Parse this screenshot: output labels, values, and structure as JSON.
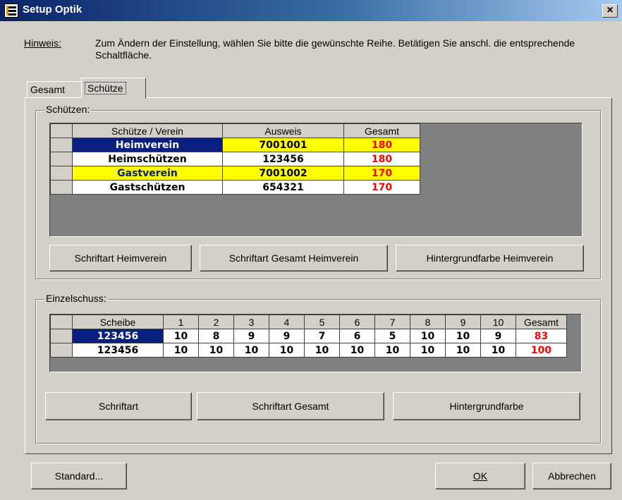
{
  "window": {
    "title": "Setup Optik",
    "close_label": "×"
  },
  "hint": {
    "label": "Hinweis:",
    "text": "Zum Ändern der Einstellung, wählen Sie bitte die gewünschte Reihe. Betätigen Sie anschl. die entsprechende Schaltfläche."
  },
  "tabs": [
    {
      "label": "Gesamt"
    },
    {
      "label": "Schütze"
    }
  ],
  "schuetzen": {
    "title": "Schützen:",
    "columns": [
      "Schütze / Verein",
      "Ausweis",
      "Gesamt"
    ],
    "rows": [
      {
        "name": "Heimverein",
        "ausweis": "7001001",
        "gesamt": "180"
      },
      {
        "name": "Heimschützen",
        "ausweis": "123456",
        "gesamt": "180"
      },
      {
        "name": "Gastverein",
        "ausweis": "7001002",
        "gesamt": "170"
      },
      {
        "name": "Gastschützen",
        "ausweis": "654321",
        "gesamt": "170"
      }
    ],
    "buttons": [
      "Schriftart Heimverein",
      "Schriftart Gesamt Heimverein",
      "Hintergrundfarbe Heimverein"
    ]
  },
  "einzelschuss": {
    "title": "Einzelschuss:",
    "columns": [
      "Scheibe",
      "1",
      "2",
      "3",
      "4",
      "5",
      "6",
      "7",
      "8",
      "9",
      "10",
      "Gesamt"
    ],
    "rows": [
      {
        "values": [
          "123456",
          "10",
          "8",
          "9",
          "9",
          "7",
          "6",
          "5",
          "10",
          "10",
          "9",
          "83"
        ]
      },
      {
        "values": [
          "123456",
          "10",
          "10",
          "10",
          "10",
          "10",
          "10",
          "10",
          "10",
          "10",
          "10",
          "100"
        ]
      }
    ],
    "buttons": [
      "Schriftart",
      "Schriftart Gesamt",
      "Hintergrundfarbe"
    ]
  },
  "footer": {
    "standard": "Standard...",
    "ok": "OK",
    "cancel": "Abbrechen"
  },
  "colors": {
    "highlight_navy": "#0a2080",
    "highlight_yellow": "#ffff00",
    "total_red": "#ff0000"
  }
}
